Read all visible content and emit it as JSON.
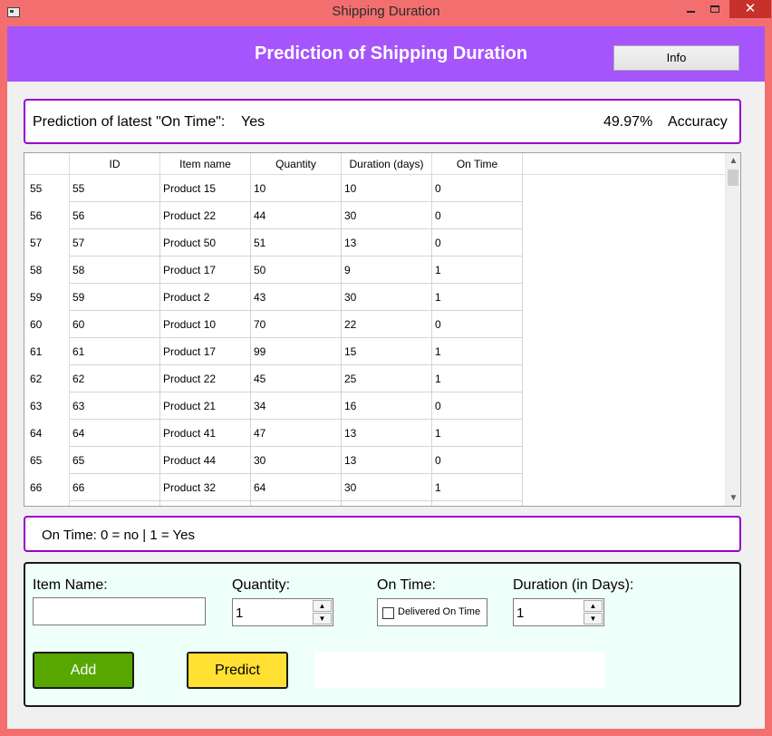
{
  "window": {
    "title": "Shipping Duration",
    "controls": {
      "minimize_icon": "minimize-icon",
      "maximize_icon": "maximize-icon",
      "close_glyph": "✕"
    }
  },
  "header": {
    "title": "Prediction of Shipping Duration",
    "info_button": "Info",
    "background": "#a555fb"
  },
  "prediction": {
    "label": "Prediction of latest \"On Time\":",
    "value": "Yes",
    "accuracy_value": "49.97%",
    "accuracy_label": "Accuracy",
    "border_color": "#9900cc"
  },
  "table": {
    "columns": [
      "ID",
      "Item name",
      "Quantity",
      "Duration (days)",
      "On Time"
    ],
    "rows": [
      {
        "row": "55",
        "cells": [
          "55",
          "Product 15",
          "10",
          "10",
          "0"
        ]
      },
      {
        "row": "56",
        "cells": [
          "56",
          "Product 22",
          "44",
          "30",
          "0"
        ]
      },
      {
        "row": "57",
        "cells": [
          "57",
          "Product 50",
          "51",
          "13",
          "0"
        ]
      },
      {
        "row": "58",
        "cells": [
          "58",
          "Product 17",
          "50",
          "9",
          "1"
        ]
      },
      {
        "row": "59",
        "cells": [
          "59",
          "Product 2",
          "43",
          "30",
          "1"
        ]
      },
      {
        "row": "60",
        "cells": [
          "60",
          "Product 10",
          "70",
          "22",
          "0"
        ]
      },
      {
        "row": "61",
        "cells": [
          "61",
          "Product 17",
          "99",
          "15",
          "1"
        ]
      },
      {
        "row": "62",
        "cells": [
          "62",
          "Product 22",
          "45",
          "25",
          "1"
        ]
      },
      {
        "row": "63",
        "cells": [
          "63",
          "Product 21",
          "34",
          "16",
          "0"
        ]
      },
      {
        "row": "64",
        "cells": [
          "64",
          "Product 41",
          "47",
          "13",
          "1"
        ]
      },
      {
        "row": "65",
        "cells": [
          "65",
          "Product 44",
          "30",
          "13",
          "0"
        ]
      },
      {
        "row": "66",
        "cells": [
          "66",
          "Product 32",
          "64",
          "30",
          "1"
        ]
      },
      {
        "row": "",
        "cells": [
          "",
          "",
          "",
          "",
          ""
        ]
      }
    ]
  },
  "legend": {
    "text": "On Time: 0 = no | 1 = Yes"
  },
  "form": {
    "item_name_label": "Item Name:",
    "item_name_value": "",
    "quantity_label": "Quantity:",
    "quantity_value": "1",
    "on_time_label": "On Time:",
    "on_time_checkbox_label": "Delivered On Time",
    "on_time_checked": false,
    "duration_label": "Duration (in Days):",
    "duration_value": "1",
    "add_button": "Add",
    "predict_button": "Predict",
    "result_text": "",
    "add_color": "#57a700",
    "predict_color": "#ffe033"
  }
}
